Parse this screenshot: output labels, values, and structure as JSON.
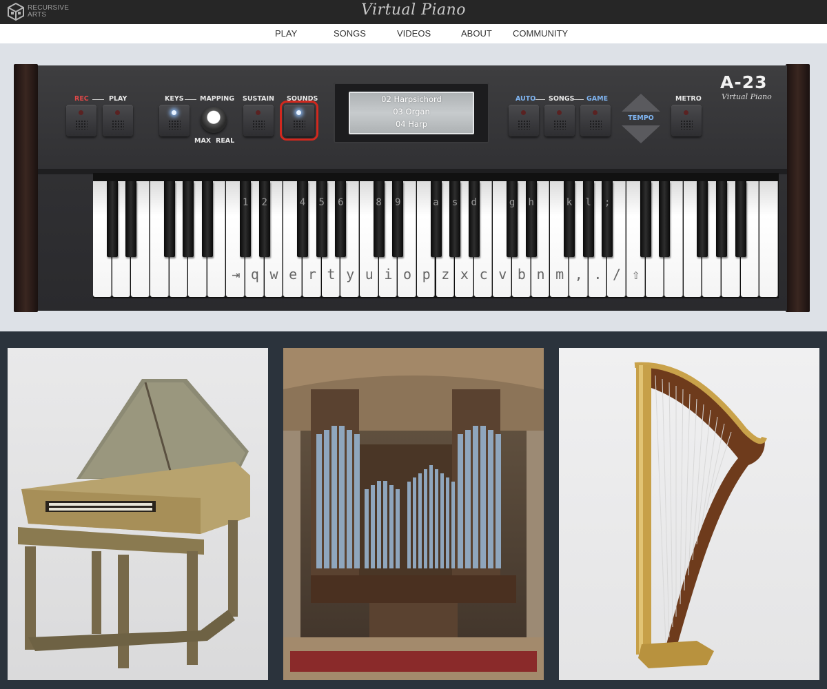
{
  "brand": {
    "line1": "RECURSIVE",
    "line2": "ARTS"
  },
  "site_title": "Virtual Piano",
  "nav": [
    "PLAY",
    "SONGS",
    "VIDEOS",
    "ABOUT",
    "COMMUNITY"
  ],
  "controls": {
    "rec": "REC",
    "play": "PLAY",
    "keys": "KEYS",
    "mapping": "MAPPING",
    "max": "MAX",
    "real": "REAL",
    "sustain": "SUSTAIN",
    "sounds": "SOUNDS",
    "auto": "AUTO",
    "songs": "SONGS",
    "game": "GAME",
    "tempo": "TEMPO",
    "metro": "METRO"
  },
  "display": [
    "02 Harpsichord",
    "03 Organ",
    "04 Harp"
  ],
  "model": {
    "name": "A-23",
    "subtitle": "Virtual Piano"
  },
  "keyboard": {
    "black_labels": [
      "1",
      "2",
      "4",
      "5",
      "6",
      "8",
      "9",
      "a",
      "s",
      "d",
      "g",
      "h",
      "k",
      "l",
      ";"
    ],
    "white_labels": [
      "⇥",
      "q",
      "w",
      "e",
      "r",
      "t",
      "y",
      "u",
      "i",
      "o",
      "p",
      "z",
      "x",
      "c",
      "v",
      "b",
      "n",
      "m",
      ",",
      ".",
      "/",
      "⇧"
    ]
  },
  "colors": {
    "accent_red": "#d2281e",
    "label_blue": "#7fb4f0",
    "rec_red": "#e04848"
  },
  "photos": [
    "harpsichord-photo",
    "pipe-organ-photo",
    "harp-photo"
  ]
}
